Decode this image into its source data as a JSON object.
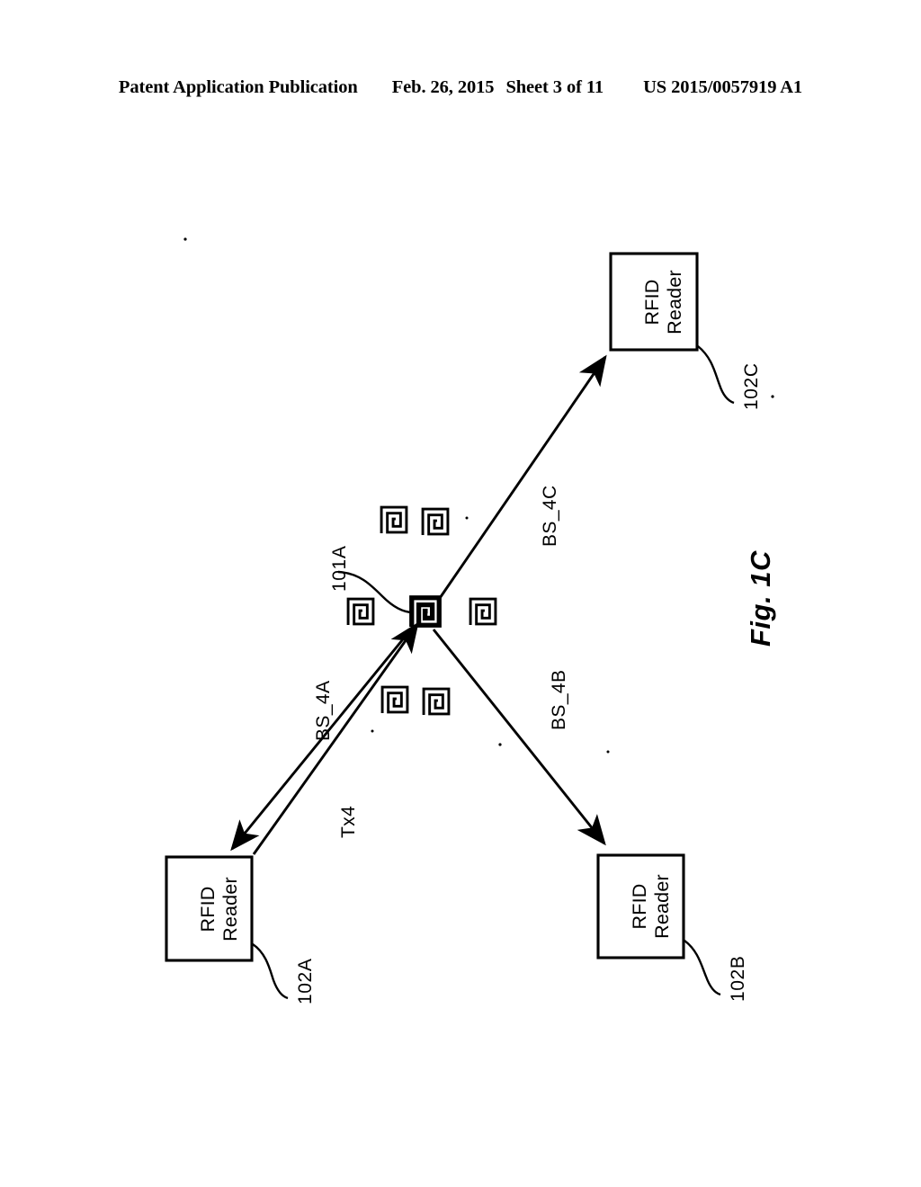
{
  "header": {
    "publication": "Patent Application Publication",
    "date": "Feb. 26, 2015",
    "sheet": "Sheet 3 of 11",
    "pub_number": "US 2015/0057919 A1"
  },
  "figure": {
    "caption": "Fig. 1C",
    "readers": [
      {
        "id": "reader-c",
        "line1": "RFID",
        "line2": "Reader",
        "ref": "102C"
      },
      {
        "id": "reader-a",
        "line1": "RFID",
        "line2": "Reader",
        "ref": "102A"
      },
      {
        "id": "reader-b",
        "line1": "RFID",
        "line2": "Reader",
        "ref": "102B"
      }
    ],
    "tag_cluster": {
      "highlighted_ref": "101A",
      "tag_count": 7,
      "highlighted_index": 0
    },
    "signals": [
      {
        "id": "bs4a",
        "label": "BS_4A"
      },
      {
        "id": "tx4",
        "label": "Tx4"
      },
      {
        "id": "bs4b",
        "label": "BS_4B"
      },
      {
        "id": "bs4c",
        "label": "BS_4C"
      }
    ]
  }
}
